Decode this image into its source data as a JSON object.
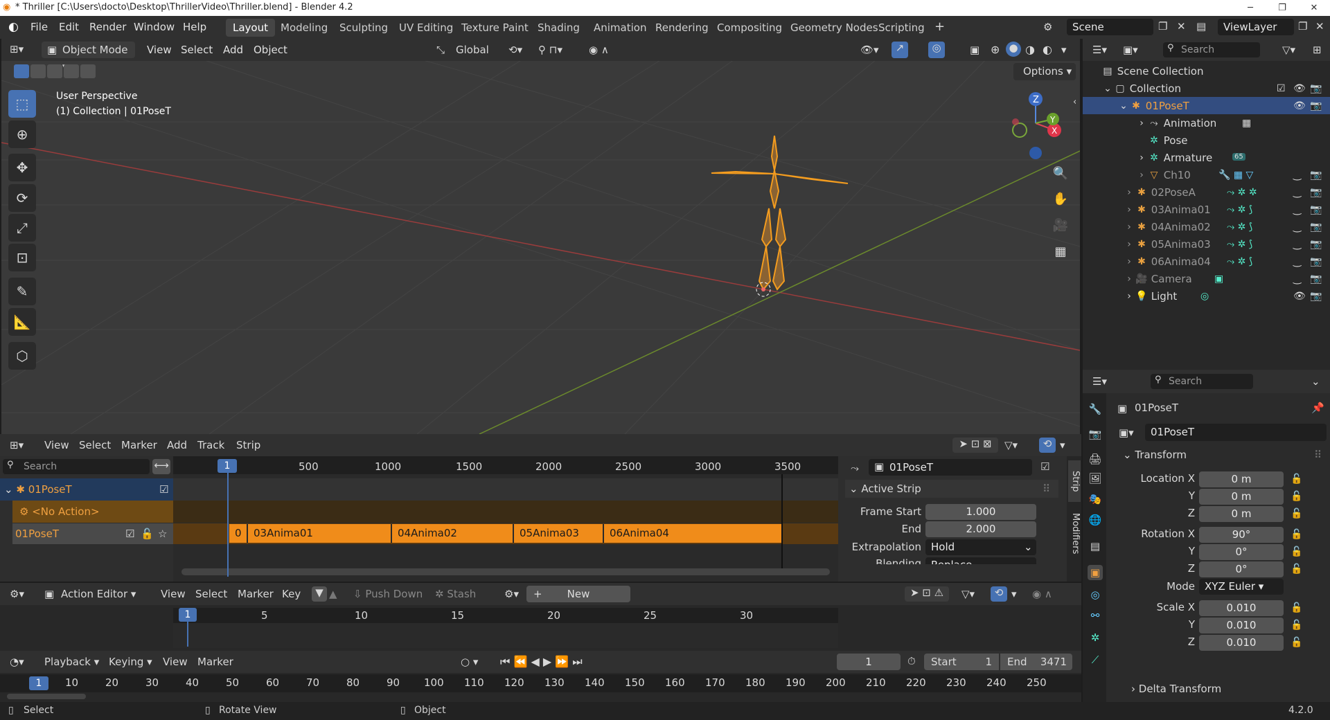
{
  "window": {
    "title": "* Thriller [C:\\Users\\docto\\Desktop\\ThrillerVideo\\Thriller.blend] - Blender 4.2",
    "version": "4.2.0"
  },
  "menu": [
    "File",
    "Edit",
    "Render",
    "Window",
    "Help"
  ],
  "workspaces": [
    "Layout",
    "Modeling",
    "Sculpting",
    "UV Editing",
    "Texture Paint",
    "Shading",
    "Animation",
    "Rendering",
    "Compositing",
    "Geometry Nodes",
    "Scripting"
  ],
  "scene": "Scene",
  "view_layer": "ViewLayer",
  "viewport": {
    "mode": "Object Mode",
    "menus": [
      "View",
      "Select",
      "Add",
      "Object"
    ],
    "orientation": "Global",
    "options": "Options",
    "overlay_line1": "User Perspective",
    "overlay_line2": "(1) Collection | 01PoseT"
  },
  "outliner": {
    "search_placeholder": "Search",
    "rows": [
      "Scene Collection",
      "Collection",
      "01PoseT",
      "Animation",
      "Pose",
      "Armature",
      "Ch10",
      "02PoseA",
      "03Anima01",
      "04Anima02",
      "05Anima03",
      "06Anima04",
      "Camera",
      "Light"
    ],
    "armature_badge": "65"
  },
  "properties": {
    "search_placeholder": "Search",
    "object_name": "01PoseT",
    "datablock": "01PoseT",
    "transform": "Transform",
    "location_label": "Location X",
    "lx": "0 m",
    "ly": "0 m",
    "lz": "0 m",
    "rotation_label": "Rotation X",
    "rx": "90°",
    "ry": "0°",
    "rz": "0°",
    "mode_label": "Mode",
    "mode": "XYZ Euler",
    "scale_label": "Scale X",
    "sx": "0.010",
    "sy": "0.010",
    "sz": "0.010",
    "y": "Y",
    "z": "Z",
    "delta": "Delta Transform"
  },
  "nla": {
    "menus": [
      "View",
      "Select",
      "Marker",
      "Add",
      "Track",
      "Strip"
    ],
    "search_placeholder": "Search",
    "track_object": "01PoseT",
    "no_action": "<No Action>",
    "track": "01PoseT",
    "ticks": [
      "500",
      "1000",
      "1500",
      "2000",
      "2500",
      "3000",
      "3500"
    ],
    "current_frame": "1",
    "strips": [
      "0",
      "03Anima01",
      "04Anima02",
      "05Anima03",
      "06Anima04"
    ],
    "sidebar": {
      "tab_strip": "Strip",
      "tab_modifiers": "Modifiers",
      "strip_name": "01PoseT",
      "panel": "Active Strip",
      "frame_start_label": "Frame Start",
      "frame_start": "1.000",
      "end_label": "End",
      "end": "2.000",
      "extrapolation_label": "Extrapolation",
      "extrapolation": "Hold",
      "blending_label": "Blending",
      "blending": "Replace"
    }
  },
  "action_editor": {
    "mode": "Action Editor",
    "menus": [
      "View",
      "Select",
      "Marker",
      "Key"
    ],
    "push_down": "Push Down",
    "stash": "Stash",
    "new": "New",
    "ticks": [
      "5",
      "10",
      "15",
      "20",
      "25",
      "30"
    ],
    "current_frame": "1"
  },
  "timeline": {
    "menus": [
      "Playback",
      "Keying",
      "View",
      "Marker"
    ],
    "frame": "1",
    "start_label": "Start",
    "start": "1",
    "end_label": "End",
    "end": "3471",
    "current_frame": "1",
    "ticks": [
      "10",
      "20",
      "30",
      "40",
      "50",
      "60",
      "70",
      "80",
      "90",
      "100",
      "110",
      "120",
      "130",
      "140",
      "150",
      "160",
      "170",
      "180",
      "190",
      "200",
      "210",
      "220",
      "230",
      "240",
      "250"
    ]
  },
  "status": {
    "select": "Select",
    "rotate": "Rotate View",
    "object": "Object"
  },
  "gizmo": {
    "z": "Z",
    "y": "Y",
    "x": "X"
  }
}
